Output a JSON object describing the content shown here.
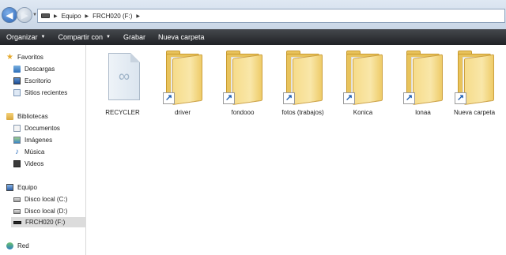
{
  "address": {
    "crumbs": [
      "Equipo",
      "FRCH020 (F:)"
    ]
  },
  "toolbar": {
    "organize": "Organizar",
    "share": "Compartir con",
    "burn": "Grabar",
    "new_folder": "Nueva carpeta"
  },
  "sidebar": {
    "favorites": "Favoritos",
    "downloads": "Descargas",
    "desktop": "Escritorio",
    "recent": "Sitios recientes",
    "libraries": "Bibliotecas",
    "documents": "Documentos",
    "images": "Imágenes",
    "music": "Música",
    "videos": "Videos",
    "computer": "Equipo",
    "local_c": "Disco local (C:)",
    "local_d": "Disco local (D:)",
    "usb_f": "FRCH020 (F:)",
    "network": "Red"
  },
  "items": [
    {
      "name": "RECYCLER",
      "icon": "document-icon"
    },
    {
      "name": "driver",
      "icon": "folder-shortcut-icon"
    },
    {
      "name": "fondooo",
      "icon": "folder-shortcut-icon"
    },
    {
      "name": "fotos (trabajos)",
      "icon": "folder-shortcut-icon"
    },
    {
      "name": "Konica",
      "icon": "folder-shortcut-icon"
    },
    {
      "name": "lonaa",
      "icon": "folder-shortcut-icon"
    },
    {
      "name": "Nueva carpeta",
      "icon": "folder-shortcut-icon"
    }
  ]
}
